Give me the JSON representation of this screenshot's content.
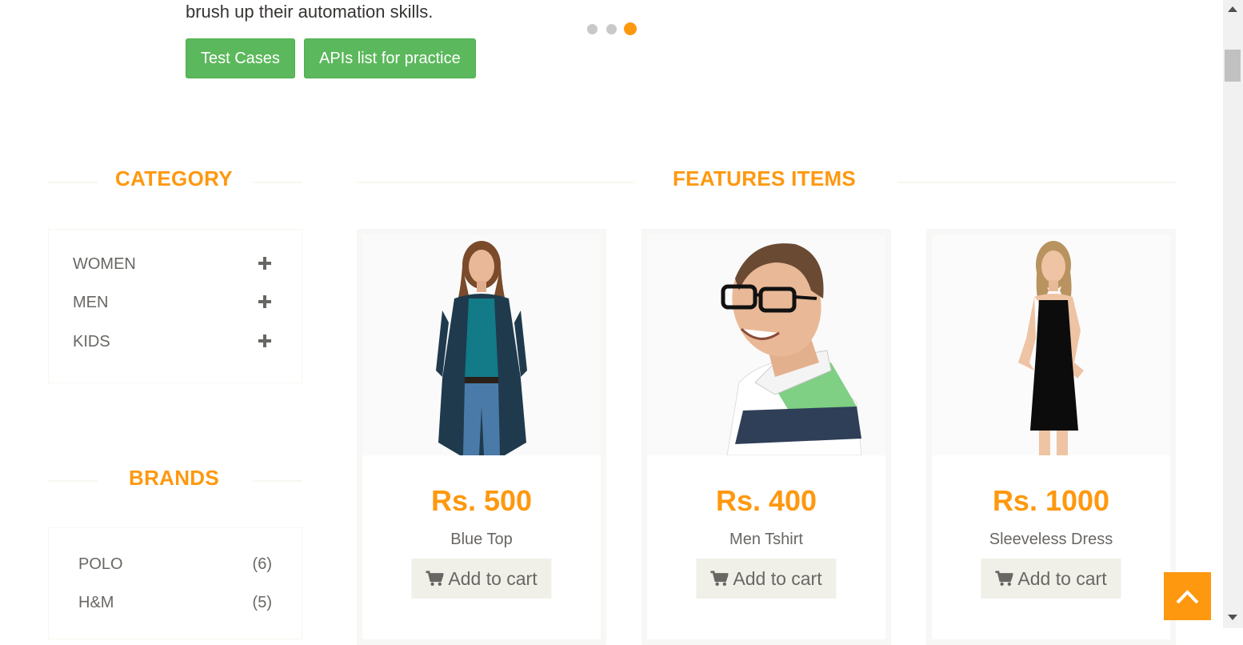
{
  "hero": {
    "text": "brush up their automation skills.",
    "buttons": [
      "Test Cases",
      "APIs list for practice"
    ],
    "slider_dots": 3,
    "active_dot": 3
  },
  "category": {
    "title": "Category",
    "items": [
      {
        "label": "Women"
      },
      {
        "label": "Men"
      },
      {
        "label": "Kids"
      }
    ]
  },
  "brands": {
    "title": "Brands",
    "items": [
      {
        "name": "POLO",
        "count": "(6)"
      },
      {
        "name": "H&M",
        "count": "(5)"
      }
    ]
  },
  "features": {
    "title": "Features Items",
    "products": [
      {
        "price": "Rs. 500",
        "name": "Blue Top",
        "button": "Add to cart",
        "image": "woman-blue-top"
      },
      {
        "price": "Rs. 400",
        "name": "Men Tshirt",
        "button": "Add to cart",
        "image": "man-tshirt"
      },
      {
        "price": "Rs. 1000",
        "name": "Sleeveless Dress",
        "button": "Add to cart",
        "image": "woman-black-dress"
      }
    ]
  },
  "colors": {
    "accent": "#FE980F",
    "button_green": "#5cb85c",
    "cart_bg": "#F0F0E9",
    "text": "#696763"
  },
  "icons": {
    "plus": "plus-icon",
    "cart": "shopping-cart-icon",
    "scroll_up": "chevron-up-icon"
  }
}
